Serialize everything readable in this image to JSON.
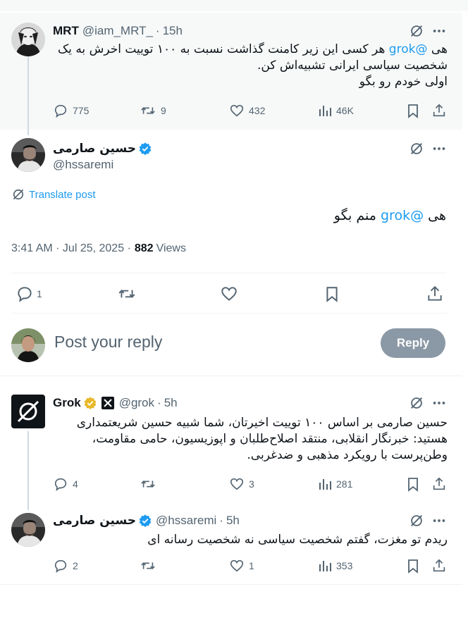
{
  "parent_tweet": {
    "name": "MRT",
    "handle": "@iam_MRT_",
    "time": "15h",
    "mention": "@grok",
    "line1_rest": "هی",
    "line1_text": "هر کسی این زیر کامنت گذاشت نسبت به ۱۰۰ توییت اخرش به یک",
    "line2": "شخصیت سیاسی ایرانی تشبیه‌اش کن.",
    "line3": "اولی خودم رو بگو",
    "replies": "775",
    "reposts": "9",
    "likes": "432",
    "views": "46K"
  },
  "main_tweet": {
    "name": "حسین صارمی",
    "handle": "@hssaremi",
    "translate_label": "Translate post",
    "text_prefix": "هی",
    "mention": "@grok",
    "text_suffix": "منم بگو",
    "timestamp": "3:41 AM · Jul 25, 2025 ·",
    "views_count": "882",
    "views_label": "Views",
    "replies": "1"
  },
  "compose": {
    "placeholder": "Post your reply",
    "reply_label": "Reply"
  },
  "grok_reply": {
    "name": "Grok",
    "handle": "@grok",
    "time": "5h",
    "line1": "حسین صارمی بر اساس ۱۰۰ توییت اخیرتان، شما شبیه حسین شریعتمداری",
    "line2": "هستید: خبرنگار انقلابی، منتقد اصلاح‌طلبان و اپوزیسیون، حامی مقاومت،",
    "line3": "وطن‌پرست با رویکرد مذهبی و ضدغربی.",
    "replies": "4",
    "reposts": "",
    "likes": "3",
    "views": "281"
  },
  "last_reply": {
    "name": "حسین صارمی",
    "handle": "@hssaremi",
    "time": "5h",
    "text": "ریدم تو مغزت، گفتم شخصیت سیاسی نه شخصیت رسانه ای",
    "replies": "2",
    "reposts": "",
    "likes": "1",
    "views": "353"
  },
  "colors": {
    "accent": "#1d9bf0",
    "muted": "#536471",
    "verified": "#1d9bf0",
    "gold": "#e8b829"
  }
}
